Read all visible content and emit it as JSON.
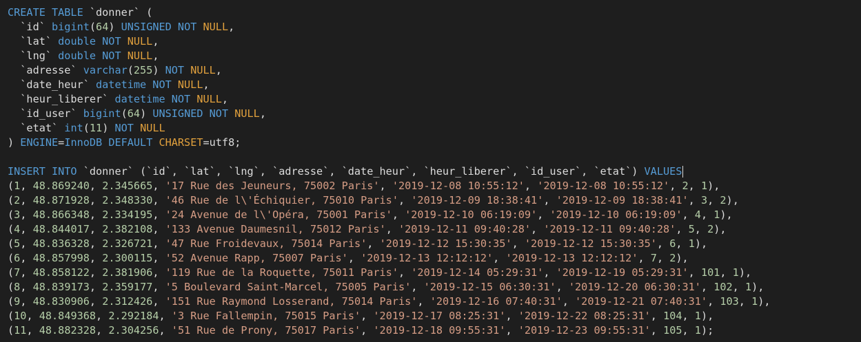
{
  "editor": {
    "colors": {
      "background": "#1e1e1e",
      "keyword": "#569cd6",
      "null_keyword": "#e2a13d",
      "number": "#b5cea8",
      "string": "#d69d85",
      "identifier": "#dcdcdc"
    },
    "lines": [
      [
        [
          "kw",
          "CREATE TABLE"
        ],
        [
          "id",
          " `donner` ("
        ]
      ],
      [
        [
          "id",
          "  `id` "
        ],
        [
          "kw",
          "bigint"
        ],
        [
          "id",
          "("
        ],
        [
          "num",
          "64"
        ],
        [
          "id",
          ") "
        ],
        [
          "kw",
          "UNSIGNED NOT "
        ],
        [
          "nl",
          "NULL"
        ],
        [
          "id",
          ","
        ]
      ],
      [
        [
          "id",
          "  `lat` "
        ],
        [
          "kw",
          "double NOT "
        ],
        [
          "nl",
          "NULL"
        ],
        [
          "id",
          ","
        ]
      ],
      [
        [
          "id",
          "  `lng` "
        ],
        [
          "kw",
          "double NOT "
        ],
        [
          "nl",
          "NULL"
        ],
        [
          "id",
          ","
        ]
      ],
      [
        [
          "id",
          "  `adresse` "
        ],
        [
          "kw",
          "varchar"
        ],
        [
          "id",
          "("
        ],
        [
          "num",
          "255"
        ],
        [
          "id",
          ") "
        ],
        [
          "kw",
          "NOT "
        ],
        [
          "nl",
          "NULL"
        ],
        [
          "id",
          ","
        ]
      ],
      [
        [
          "id",
          "  `date_heur` "
        ],
        [
          "kw",
          "datetime NOT "
        ],
        [
          "nl",
          "NULL"
        ],
        [
          "id",
          ","
        ]
      ],
      [
        [
          "id",
          "  `heur_liberer` "
        ],
        [
          "kw",
          "datetime NOT "
        ],
        [
          "nl",
          "NULL"
        ],
        [
          "id",
          ","
        ]
      ],
      [
        [
          "id",
          "  `id_user` "
        ],
        [
          "kw",
          "bigint"
        ],
        [
          "id",
          "("
        ],
        [
          "num",
          "64"
        ],
        [
          "id",
          ") "
        ],
        [
          "kw",
          "UNSIGNED NOT "
        ],
        [
          "nl",
          "NULL"
        ],
        [
          "id",
          ","
        ]
      ],
      [
        [
          "id",
          "  `etat` "
        ],
        [
          "kw",
          "int"
        ],
        [
          "id",
          "("
        ],
        [
          "num",
          "11"
        ],
        [
          "id",
          ") "
        ],
        [
          "kw",
          "NOT "
        ],
        [
          "nl",
          "NULL"
        ]
      ],
      [
        [
          "id",
          ") "
        ],
        [
          "kw",
          "ENGINE"
        ],
        [
          "id",
          "="
        ],
        [
          "kw",
          "InnoDB DEFAULT "
        ],
        [
          "nl",
          "CHARSET"
        ],
        [
          "id",
          "=utf8;"
        ]
      ],
      [],
      [
        [
          "kw",
          "INSERT INTO"
        ],
        [
          "id",
          " `donner` (`id`, `lat`, `lng`, `adresse`, `date_heur`, `heur_liberer`, `id_user`, `etat`) "
        ],
        [
          "kw",
          "VALUES"
        ],
        [
          "cursor",
          ""
        ]
      ],
      [
        [
          "id",
          "("
        ],
        [
          "num",
          "1"
        ],
        [
          "id",
          ", "
        ],
        [
          "num",
          "48.869240"
        ],
        [
          "id",
          ", "
        ],
        [
          "num",
          "2.345665"
        ],
        [
          "id",
          ", "
        ],
        [
          "str",
          "'17 Rue des Jeuneurs, 75002 Paris'"
        ],
        [
          "id",
          ", "
        ],
        [
          "str",
          "'2019-12-08 10:55:12'"
        ],
        [
          "id",
          ", "
        ],
        [
          "str",
          "'2019-12-08 10:55:12'"
        ],
        [
          "id",
          ", "
        ],
        [
          "num",
          "2"
        ],
        [
          "id",
          ", "
        ],
        [
          "num",
          "1"
        ],
        [
          "id",
          "),"
        ]
      ],
      [
        [
          "id",
          "("
        ],
        [
          "num",
          "2"
        ],
        [
          "id",
          ", "
        ],
        [
          "num",
          "48.871928"
        ],
        [
          "id",
          ", "
        ],
        [
          "num",
          "2.348330"
        ],
        [
          "id",
          ", "
        ],
        [
          "str",
          "'46 Rue de l\\'Échiquier, 75010 Paris'"
        ],
        [
          "id",
          ", "
        ],
        [
          "str",
          "'2019-12-09 18:38:41'"
        ],
        [
          "id",
          ", "
        ],
        [
          "str",
          "'2019-12-09 18:38:41'"
        ],
        [
          "id",
          ", "
        ],
        [
          "num",
          "3"
        ],
        [
          "id",
          ", "
        ],
        [
          "num",
          "2"
        ],
        [
          "id",
          "),"
        ]
      ],
      [
        [
          "id",
          "("
        ],
        [
          "num",
          "3"
        ],
        [
          "id",
          ", "
        ],
        [
          "num",
          "48.866348"
        ],
        [
          "id",
          ", "
        ],
        [
          "num",
          "2.334195"
        ],
        [
          "id",
          ", "
        ],
        [
          "str",
          "'24 Avenue de l\\'Opéra, 75001 Paris'"
        ],
        [
          "id",
          ", "
        ],
        [
          "str",
          "'2019-12-10 06:19:09'"
        ],
        [
          "id",
          ", "
        ],
        [
          "str",
          "'2019-12-10 06:19:09'"
        ],
        [
          "id",
          ", "
        ],
        [
          "num",
          "4"
        ],
        [
          "id",
          ", "
        ],
        [
          "num",
          "1"
        ],
        [
          "id",
          "),"
        ]
      ],
      [
        [
          "id",
          "("
        ],
        [
          "num",
          "4"
        ],
        [
          "id",
          ", "
        ],
        [
          "num",
          "48.844017"
        ],
        [
          "id",
          ", "
        ],
        [
          "num",
          "2.382108"
        ],
        [
          "id",
          ", "
        ],
        [
          "str",
          "'133 Avenue Daumesnil, 75012 Paris'"
        ],
        [
          "id",
          ", "
        ],
        [
          "str",
          "'2019-12-11 09:40:28'"
        ],
        [
          "id",
          ", "
        ],
        [
          "str",
          "'2019-12-11 09:40:28'"
        ],
        [
          "id",
          ", "
        ],
        [
          "num",
          "5"
        ],
        [
          "id",
          ", "
        ],
        [
          "num",
          "2"
        ],
        [
          "id",
          "),"
        ]
      ],
      [
        [
          "id",
          "("
        ],
        [
          "num",
          "5"
        ],
        [
          "id",
          ", "
        ],
        [
          "num",
          "48.836328"
        ],
        [
          "id",
          ", "
        ],
        [
          "num",
          "2.326721"
        ],
        [
          "id",
          ", "
        ],
        [
          "str",
          "'47 Rue Froidevaux, 75014 Paris'"
        ],
        [
          "id",
          ", "
        ],
        [
          "str",
          "'2019-12-12 15:30:35'"
        ],
        [
          "id",
          ", "
        ],
        [
          "str",
          "'2019-12-12 15:30:35'"
        ],
        [
          "id",
          ", "
        ],
        [
          "num",
          "6"
        ],
        [
          "id",
          ", "
        ],
        [
          "num",
          "1"
        ],
        [
          "id",
          "),"
        ]
      ],
      [
        [
          "id",
          "("
        ],
        [
          "num",
          "6"
        ],
        [
          "id",
          ", "
        ],
        [
          "num",
          "48.857998"
        ],
        [
          "id",
          ", "
        ],
        [
          "num",
          "2.300115"
        ],
        [
          "id",
          ", "
        ],
        [
          "str",
          "'52 Avenue Rapp, 75007 Paris'"
        ],
        [
          "id",
          ", "
        ],
        [
          "str",
          "'2019-12-13 12:12:12'"
        ],
        [
          "id",
          ", "
        ],
        [
          "str",
          "'2019-12-13 12:12:12'"
        ],
        [
          "id",
          ", "
        ],
        [
          "num",
          "7"
        ],
        [
          "id",
          ", "
        ],
        [
          "num",
          "2"
        ],
        [
          "id",
          "),"
        ]
      ],
      [
        [
          "id",
          "("
        ],
        [
          "num",
          "7"
        ],
        [
          "id",
          ", "
        ],
        [
          "num",
          "48.858122"
        ],
        [
          "id",
          ", "
        ],
        [
          "num",
          "2.381906"
        ],
        [
          "id",
          ", "
        ],
        [
          "str",
          "'119 Rue de la Roquette, 75011 Paris'"
        ],
        [
          "id",
          ", "
        ],
        [
          "str",
          "'2019-12-14 05:29:31'"
        ],
        [
          "id",
          ", "
        ],
        [
          "str",
          "'2019-12-19 05:29:31'"
        ],
        [
          "id",
          ", "
        ],
        [
          "num",
          "101"
        ],
        [
          "id",
          ", "
        ],
        [
          "num",
          "1"
        ],
        [
          "id",
          "),"
        ]
      ],
      [
        [
          "id",
          "("
        ],
        [
          "num",
          "8"
        ],
        [
          "id",
          ", "
        ],
        [
          "num",
          "48.839173"
        ],
        [
          "id",
          ", "
        ],
        [
          "num",
          "2.359177"
        ],
        [
          "id",
          ", "
        ],
        [
          "str",
          "'5 Boulevard Saint-Marcel, 75005 Paris'"
        ],
        [
          "id",
          ", "
        ],
        [
          "str",
          "'2019-12-15 06:30:31'"
        ],
        [
          "id",
          ", "
        ],
        [
          "str",
          "'2019-12-20 06:30:31'"
        ],
        [
          "id",
          ", "
        ],
        [
          "num",
          "102"
        ],
        [
          "id",
          ", "
        ],
        [
          "num",
          "1"
        ],
        [
          "id",
          "),"
        ]
      ],
      [
        [
          "id",
          "("
        ],
        [
          "num",
          "9"
        ],
        [
          "id",
          ", "
        ],
        [
          "num",
          "48.830906"
        ],
        [
          "id",
          ", "
        ],
        [
          "num",
          "2.312426"
        ],
        [
          "id",
          ", "
        ],
        [
          "str",
          "'151 Rue Raymond Losserand, 75014 Paris'"
        ],
        [
          "id",
          ", "
        ],
        [
          "str",
          "'2019-12-16 07:40:31'"
        ],
        [
          "id",
          ", "
        ],
        [
          "str",
          "'2019-12-21 07:40:31'"
        ],
        [
          "id",
          ", "
        ],
        [
          "num",
          "103"
        ],
        [
          "id",
          ", "
        ],
        [
          "num",
          "1"
        ],
        [
          "id",
          "),"
        ]
      ],
      [
        [
          "id",
          "("
        ],
        [
          "num",
          "10"
        ],
        [
          "id",
          ", "
        ],
        [
          "num",
          "48.849368"
        ],
        [
          "id",
          ", "
        ],
        [
          "num",
          "2.292184"
        ],
        [
          "id",
          ", "
        ],
        [
          "str",
          "'3 Rue Fallempin, 75015 Paris'"
        ],
        [
          "id",
          ", "
        ],
        [
          "str",
          "'2019-12-17 08:25:31'"
        ],
        [
          "id",
          ", "
        ],
        [
          "str",
          "'2019-12-22 08:25:31'"
        ],
        [
          "id",
          ", "
        ],
        [
          "num",
          "104"
        ],
        [
          "id",
          ", "
        ],
        [
          "num",
          "1"
        ],
        [
          "id",
          "),"
        ]
      ],
      [
        [
          "id",
          "("
        ],
        [
          "num",
          "11"
        ],
        [
          "id",
          ", "
        ],
        [
          "num",
          "48.882328"
        ],
        [
          "id",
          ", "
        ],
        [
          "num",
          "2.304256"
        ],
        [
          "id",
          ", "
        ],
        [
          "str",
          "'51 Rue de Prony, 75017 Paris'"
        ],
        [
          "id",
          ", "
        ],
        [
          "str",
          "'2019-12-18 09:55:31'"
        ],
        [
          "id",
          ", "
        ],
        [
          "str",
          "'2019-12-23 09:55:31'"
        ],
        [
          "id",
          ", "
        ],
        [
          "num",
          "105"
        ],
        [
          "id",
          ", "
        ],
        [
          "num",
          "1"
        ],
        [
          "id",
          ");"
        ]
      ]
    ]
  }
}
